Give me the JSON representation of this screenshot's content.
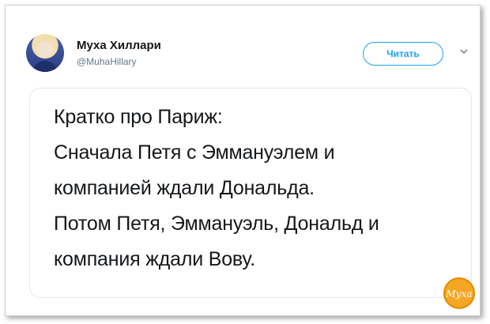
{
  "tweet": {
    "author_name": "Муха Хиллари",
    "author_handle": "@MuhaHillary",
    "follow_label": "Читать",
    "lines": [
      "Кратко про Париж:",
      "Сначала Петя с Эммануэлем и",
      "компанией ждали Дональда.",
      "Потом Петя, Эммануэль, Дональд и",
      "компания ждали Вову."
    ]
  },
  "watermark": {
    "text": "Муха"
  },
  "colors": {
    "accent": "#1da1f2",
    "watermark": "#f5a623"
  }
}
